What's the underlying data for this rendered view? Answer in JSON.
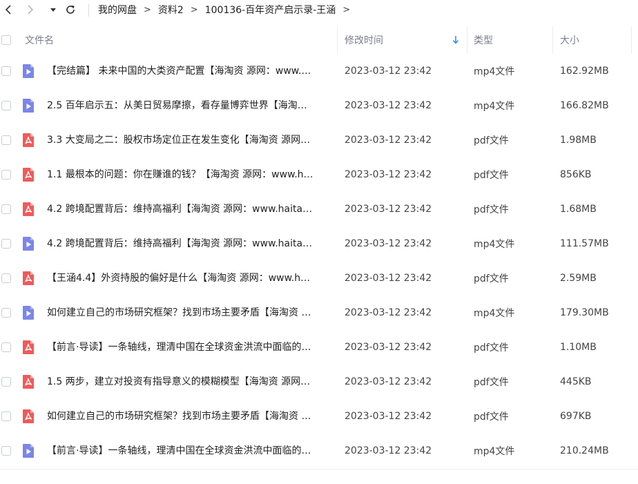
{
  "nav": {
    "breadcrumb": [
      "我的网盘",
      "资料2",
      "100136-百年资产启示录-王涵"
    ],
    "separator": ">"
  },
  "table": {
    "columns": {
      "name": "文件名",
      "modified": "修改时间",
      "type": "类型",
      "size": "大小"
    },
    "sort": {
      "column": "modified",
      "direction": "descending"
    },
    "rows": [
      {
        "kind": "video",
        "name": "【完结篇】 未来中国的大类资产配置【海淘资 源网：www.…",
        "modified": "2023-03-12 23:42",
        "type": "mp4文件",
        "size": "162.92MB"
      },
      {
        "kind": "video",
        "name": "2.5 百年启示五：从美日贸易摩擦，看存量博弈世界【海淘…",
        "modified": "2023-03-12 23:42",
        "type": "mp4文件",
        "size": "166.82MB"
      },
      {
        "kind": "pdf",
        "name": "3.3 大变局之二：股权市场定位正在发生变化【海淘资 源网…",
        "modified": "2023-03-12 23:42",
        "type": "pdf文件",
        "size": "1.98MB"
      },
      {
        "kind": "pdf",
        "name": "1.1 最根本的问题：你在赚谁的钱？【海淘资 源网：www.h…",
        "modified": "2023-03-12 23:42",
        "type": "pdf文件",
        "size": "856KB"
      },
      {
        "kind": "pdf",
        "name": "4.2 跨境配置背后：维持高福利【海淘资 源网：www.haita…",
        "modified": "2023-03-12 23:42",
        "type": "pdf文件",
        "size": "1.68MB"
      },
      {
        "kind": "video",
        "name": "4.2 跨境配置背后：维持高福利【海淘资 源网：www.haita…",
        "modified": "2023-03-12 23:42",
        "type": "mp4文件",
        "size": "111.57MB"
      },
      {
        "kind": "pdf",
        "name": "【王涵4.4】外资持股的偏好是什么【海淘资 源网：www.h…",
        "modified": "2023-03-12 23:42",
        "type": "pdf文件",
        "size": "2.59MB"
      },
      {
        "kind": "video",
        "name": "如何建立自己的市场研究框架？找到市场主要矛盾【海淘资 …",
        "modified": "2023-03-12 23:42",
        "type": "mp4文件",
        "size": "179.30MB"
      },
      {
        "kind": "pdf",
        "name": "【前言·导读】一条轴线，理清中国在全球资金洪流中面临的…",
        "modified": "2023-03-12 23:42",
        "type": "pdf文件",
        "size": "1.10MB"
      },
      {
        "kind": "pdf",
        "name": "1.5 两步，建立对投资有指导意义的模糊模型【海淘资 源网…",
        "modified": "2023-03-12 23:42",
        "type": "pdf文件",
        "size": "445KB"
      },
      {
        "kind": "pdf",
        "name": "如何建立自己的市场研究框架？找到市场主要矛盾【海淘资 …",
        "modified": "2023-03-12 23:42",
        "type": "pdf文件",
        "size": "697KB"
      },
      {
        "kind": "video",
        "name": "【前言·导读】一条轴线，理清中国在全球资金洪流中面临的…",
        "modified": "2023-03-12 23:42",
        "type": "mp4文件",
        "size": "210.24MB"
      }
    ]
  },
  "colors": {
    "video_icon": "#7b86e8",
    "pdf_icon": "#f05a5a",
    "sort_arrow": "#3a8bf0",
    "header_text": "#7a7f87"
  }
}
